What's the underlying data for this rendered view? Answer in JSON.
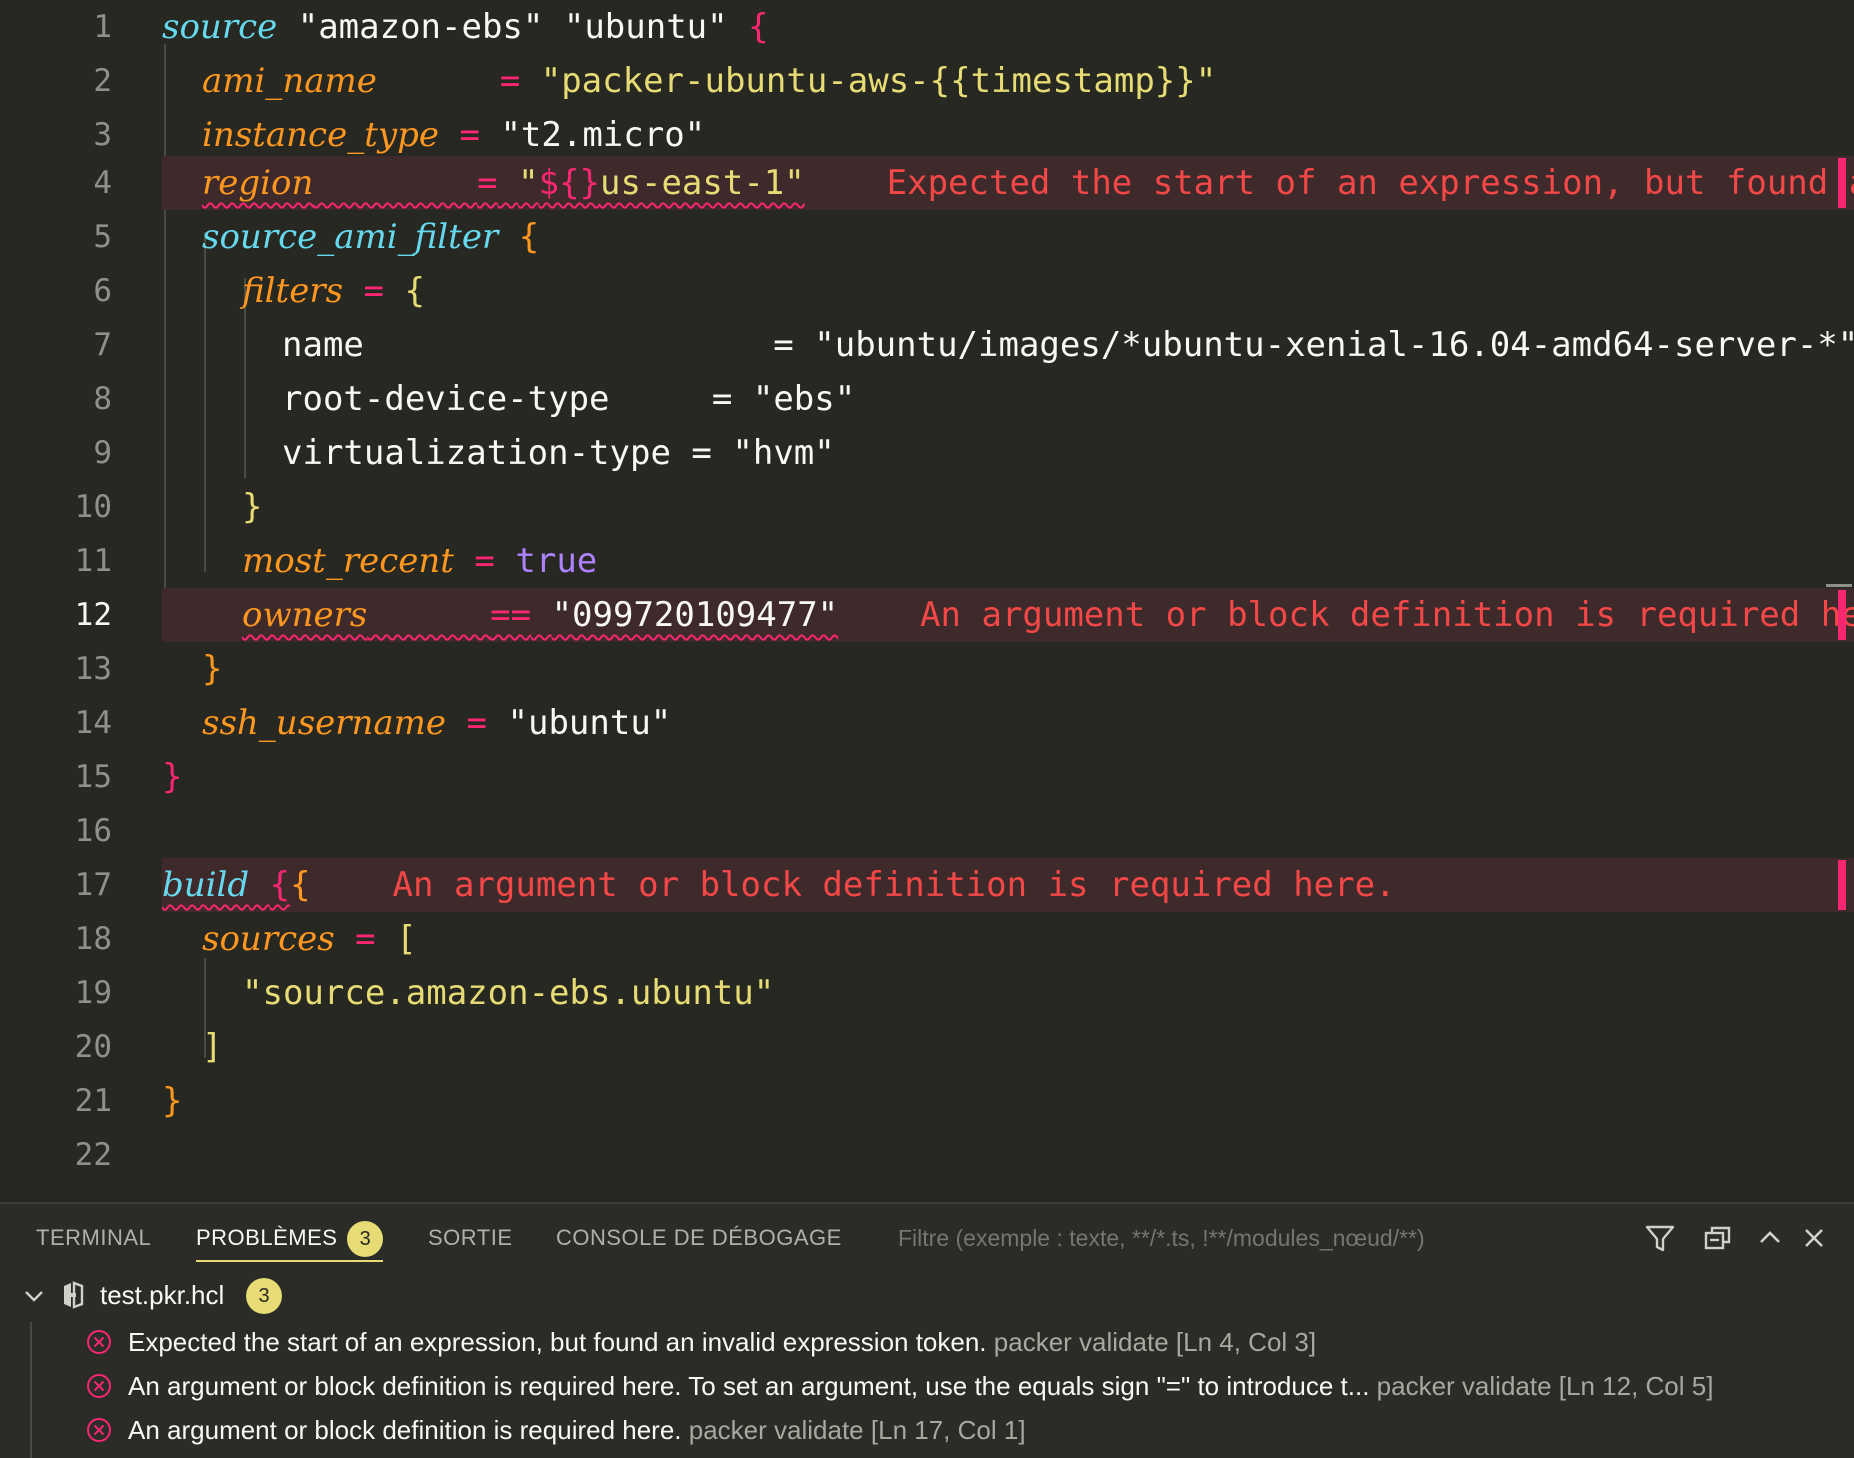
{
  "editor": {
    "line_numbers": [
      "1",
      "2",
      "3",
      "4",
      "5",
      "6",
      "7",
      "8",
      "9",
      "10",
      "11",
      "12",
      "13",
      "14",
      "15",
      "16",
      "17",
      "18",
      "19",
      "20",
      "21",
      "22"
    ],
    "l1": {
      "kw": "source",
      "s1": "\"amazon-ebs\"",
      "s2": "\"ubuntu\"",
      "brace": "{"
    },
    "l2": {
      "attr": "ami_name",
      "pad": "      ",
      "eq": "=",
      "val": "\"packer-ubuntu-aws-{{timestamp}}\""
    },
    "l3": {
      "attr": "instance_type",
      "eq": "=",
      "val": "\"t2.micro\""
    },
    "l4": {
      "attr": "region",
      "pad": "        ",
      "eq": "=",
      "q1": "\"",
      "interp": "${}",
      "val": "us-east-1\"",
      "message": "Expected the start of an expression, but found an"
    },
    "l5": {
      "kw": "source_ami_filter",
      "brace": "{"
    },
    "l6": {
      "attr": "filters",
      "eq": "=",
      "brace": "{"
    },
    "l7": {
      "key": "name                   ",
      "eq": "=",
      "val": "\"ubuntu/images/*ubuntu-xenial-16.04-amd64-server-*\""
    },
    "l8": {
      "key": "root-device-type    ",
      "eq": "=",
      "val": "\"ebs\""
    },
    "l9": {
      "key": "virtualization-type",
      "eq": "=",
      "val": "\"hvm\""
    },
    "l10": {
      "brace": "}"
    },
    "l11": {
      "attr": "most_recent",
      "eq": "=",
      "val": "true"
    },
    "l12": {
      "attr": "owners",
      "pad": "      ",
      "eq": "==",
      "val": "\"099720109477\"",
      "message": "An argument or block definition is required here"
    },
    "l13": {
      "brace": "}"
    },
    "l14": {
      "attr": "ssh_username",
      "eq": "=",
      "val": "\"ubuntu\""
    },
    "l15": {
      "brace": "}"
    },
    "l17": {
      "kw": "build",
      "brace1": "{",
      "brace2": "{",
      "message": "An argument or block definition is required here."
    },
    "l18": {
      "attr": "sources",
      "eq": "=",
      "bracket": "["
    },
    "l19": {
      "val": "\"source.amazon-ebs.ubuntu\""
    },
    "l20": {
      "bracket": "]"
    },
    "l21": {
      "brace": "}"
    }
  },
  "panel": {
    "tabs": [
      {
        "label": "TERMINAL"
      },
      {
        "label": "PROBLÈMES",
        "badge": "3"
      },
      {
        "label": "SORTIE"
      },
      {
        "label": "CONSOLE DE DÉBOGAGE"
      }
    ],
    "filter_placeholder": "Filtre (exemple : texte, **/*.ts, !**/modules_nœud/**)",
    "file": {
      "name": "test.pkr.hcl",
      "count": "3"
    },
    "problems": [
      {
        "message": "Expected the start of an expression, but found an invalid expression token.",
        "source": "packer validate",
        "location": "[Ln 4, Col 3]"
      },
      {
        "message": "An argument or block definition is required here. To set an argument, use the equals sign \"=\" to introduce t...",
        "source": "packer validate",
        "location": "[Ln 12, Col 5]"
      },
      {
        "message": "An argument or block definition is required here.",
        "source": "packer validate",
        "location": "[Ln 17, Col 1]"
      }
    ]
  },
  "colors": {
    "background": "#272822",
    "error": "#f92672",
    "badge": "#e6db74"
  }
}
